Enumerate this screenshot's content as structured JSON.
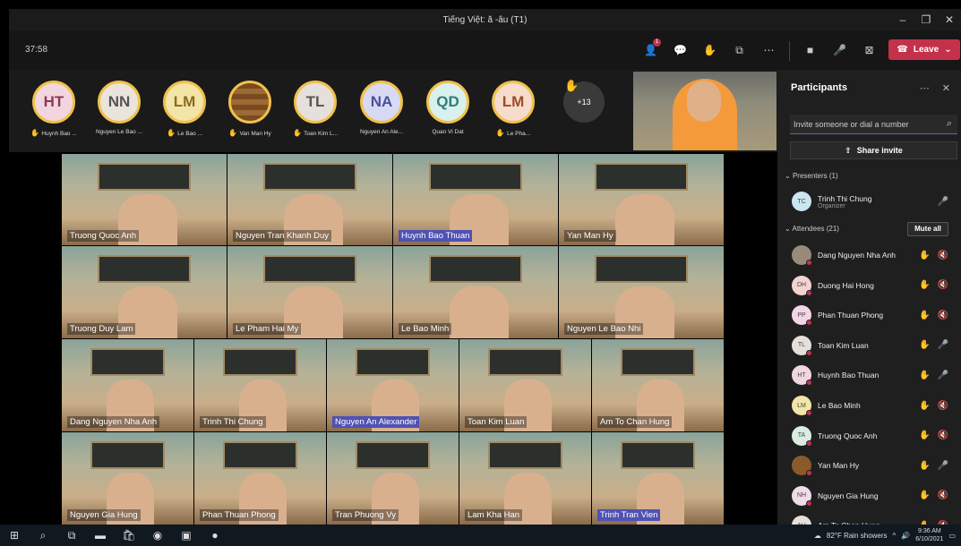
{
  "window": {
    "title": "Tiếng Việt: ă -âu (T1)",
    "minimize": "–",
    "maximize": "❐",
    "close": "✕"
  },
  "toolbar": {
    "timer": "37:58",
    "participants_badge": "1",
    "leave_label": "Leave"
  },
  "strip": {
    "avatars": [
      {
        "initials": "HT",
        "name": "Huynh Bao ...",
        "bg": "#f2d6df",
        "fg": "#8b3b55",
        "hand": true
      },
      {
        "initials": "NN",
        "name": "Nguyen Le Bao ...",
        "bg": "#eae4dd",
        "fg": "#555",
        "hand": false
      },
      {
        "initials": "LM",
        "name": "Le Bao ...",
        "bg": "#f3e4a8",
        "fg": "#8a6d1a",
        "hand": true
      },
      {
        "initials": "",
        "name": "Van Man Hy",
        "bg": "#8b5a2b",
        "fg": "#fff",
        "hand": true
      },
      {
        "initials": "TL",
        "name": "Toan Kim L...",
        "bg": "#e6e0dc",
        "fg": "#555",
        "hand": true
      },
      {
        "initials": "NA",
        "name": "Nguyen An Ale...",
        "bg": "#d7daf2",
        "fg": "#4b4f9e",
        "hand": false
      },
      {
        "initials": "QD",
        "name": "Quan Vi Dat",
        "bg": "#d9f0ee",
        "fg": "#2e7e78",
        "hand": false
      },
      {
        "initials": "LM",
        "name": "Le Pha...",
        "bg": "#f6dccd",
        "fg": "#9c4d2a",
        "hand": true
      }
    ],
    "more": "+13"
  },
  "tiles": [
    {
      "label": "Truong Quoc Anh",
      "hl": false
    },
    {
      "label": "Nguyen Tran Khanh Duy",
      "hl": false
    },
    {
      "label": "Huynh Bao Thuan",
      "hl": true
    },
    {
      "label": "Yan Man Hy",
      "hl": false
    },
    {
      "label": "Truong Duy Lam",
      "hl": false
    },
    {
      "label": "Le Pham Hai My",
      "hl": false
    },
    {
      "label": "Le Bao Minh",
      "hl": false
    },
    {
      "label": "Nguyen Le Bao Nhi",
      "hl": false
    },
    {
      "label": "Dang Nguyen Nha Anh",
      "hl": false
    },
    {
      "label": "Trinh Thi Chung",
      "hl": false
    },
    {
      "label": "Nguyen An Alexander",
      "hl": true
    },
    {
      "label": "Toan Kim Luan",
      "hl": false
    },
    {
      "label": "Am To Chan Hung",
      "hl": false
    },
    {
      "label": "Nguyen Gia Hung",
      "hl": false
    },
    {
      "label": "Phan Thuan Phong",
      "hl": false
    },
    {
      "label": "Tran Phuong Vy",
      "hl": false
    },
    {
      "label": "Lam Kha Han",
      "hl": false
    },
    {
      "label": "Trinh Tran Vien",
      "hl": true
    }
  ],
  "sidebar": {
    "title": "Participants",
    "invite_placeholder": "Invite someone or dial a number",
    "share_label": "Share invite",
    "presenters_label": "Presenters (1)",
    "attendees_label": "Attendees (21)",
    "mute_all": "Mute all",
    "presenter": {
      "initials": "TC",
      "name": "Trinh Thi Chung",
      "role": "Organizer",
      "bg": "#c9e6f2"
    },
    "attendees": [
      {
        "initials": "",
        "name": "Dang Nguyen Nha Anh",
        "bg": "#9a8a7a",
        "mic": "off"
      },
      {
        "initials": "DH",
        "name": "Duong Hai Hong",
        "bg": "#f3d2d2",
        "mic": "off"
      },
      {
        "initials": "PP",
        "name": "Phan Thuan Phong",
        "bg": "#f2d6e6",
        "mic": "off"
      },
      {
        "initials": "TL",
        "name": "Toan Kim Luan",
        "bg": "#e6e0dc",
        "mic": "on"
      },
      {
        "initials": "HT",
        "name": "Huynh Bao Thuan",
        "bg": "#f2d6df",
        "mic": "on"
      },
      {
        "initials": "LM",
        "name": "Le Bao Minh",
        "bg": "#f3e4a8",
        "mic": "off"
      },
      {
        "initials": "TA",
        "name": "Truong Quoc Anh",
        "bg": "#d9ecdf",
        "mic": "off"
      },
      {
        "initials": "",
        "name": "Yan Man Hy",
        "bg": "#8b5a2b",
        "mic": "on"
      },
      {
        "initials": "NH",
        "name": "Nguyen Gia Hung",
        "bg": "#f0dce8",
        "mic": "off"
      },
      {
        "initials": "AH",
        "name": "Am To Chan Hung",
        "bg": "#e8e0d8",
        "mic": "off"
      }
    ]
  },
  "taskbar": {
    "weather": "82°F  Rain showers",
    "time": "9:36 AM",
    "date": "6/10/2021"
  }
}
